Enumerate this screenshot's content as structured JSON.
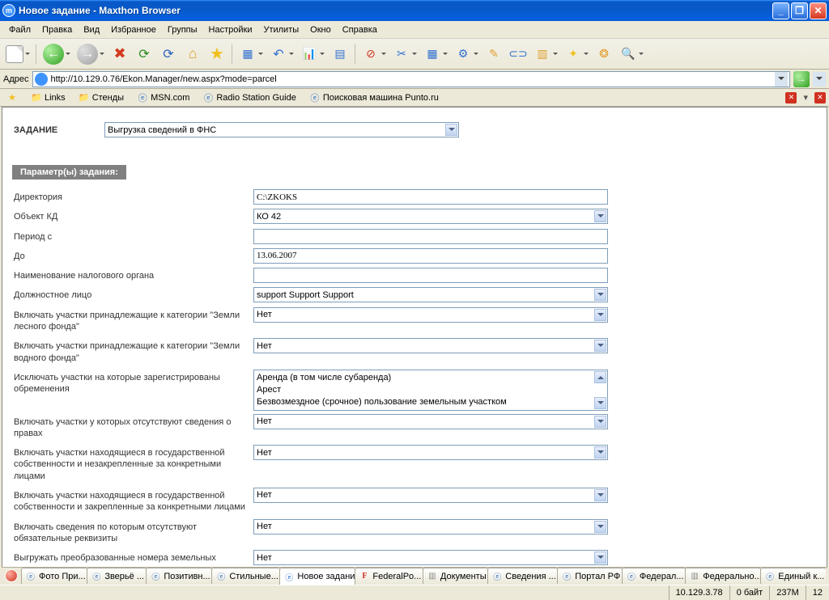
{
  "window": {
    "title": "Новое задание - Maxthon Browser"
  },
  "menu": {
    "items": [
      "Файл",
      "Правка",
      "Вид",
      "Избранное",
      "Группы",
      "Настройки",
      "Утилиты",
      "Окно",
      "Справка"
    ]
  },
  "address": {
    "label": "Адрес",
    "url": "http://10.129.0.76/Ekon.Manager/new.aspx?mode=parcel"
  },
  "links": {
    "items": [
      {
        "icon": "star",
        "label": ""
      },
      {
        "icon": "fold",
        "label": "Links"
      },
      {
        "icon": "fold",
        "label": "Стенды"
      },
      {
        "icon": "ie",
        "label": "MSN.com"
      },
      {
        "icon": "ie",
        "label": "Radio Station Guide"
      },
      {
        "icon": "ie",
        "label": "Поисковая машина Punto.ru"
      }
    ]
  },
  "form": {
    "task_label": "ЗАДАНИЕ",
    "task_value": "Выгрузка сведений в ФНС",
    "section_header": "Параметр(ы) задания:",
    "rows": [
      {
        "label": "Директория",
        "type": "text",
        "value": "C:\\ZKOKS"
      },
      {
        "label": "Объект КД",
        "type": "select",
        "value": "КО 42"
      },
      {
        "label": "Период с",
        "type": "text",
        "value": ""
      },
      {
        "label": "До",
        "type": "text",
        "value": "13.06.2007"
      },
      {
        "label": "Наименование налогового органа",
        "type": "text",
        "value": ""
      },
      {
        "label": "Должностное лицо",
        "type": "select",
        "value": "support Support Support"
      },
      {
        "label": "Включать участки принадлежащие к категории \"Земли лесного фонда\"",
        "type": "select",
        "value": "Нет"
      },
      {
        "label": "Включать участки принадлежащие к категории \"Земли водного фонда\"",
        "type": "select",
        "value": "Нет"
      },
      {
        "label": "Исключать участки на которые зарегистрированы обременения",
        "type": "multi",
        "options": [
          "Аренда (в том числе субаренда)",
          "Арест",
          "Безвозмездное (срочное) пользование земельным участком"
        ]
      },
      {
        "label": "Включать участки у которых отсутствуют сведения о правах",
        "type": "select",
        "value": "Нет"
      },
      {
        "label": "Включать участки находящиеся в государственной собственности и незакрепленные за конкретными лицами",
        "type": "select",
        "value": "Нет"
      },
      {
        "label": "Включать участки находящиеся в государственной собственности и закрепленные за конкретными лицами",
        "type": "select",
        "value": "Нет"
      },
      {
        "label": "Включать сведения по которым отсутствуют обязательные реквизиты",
        "type": "select",
        "value": "Нет"
      },
      {
        "label": "Выгружать преобразованные номера земельных участков",
        "type": "select",
        "value": "Нет"
      }
    ]
  },
  "tabs": {
    "items": [
      {
        "label": "Фото При...",
        "icon": "ie"
      },
      {
        "label": "Зверьё ...",
        "icon": "ie"
      },
      {
        "label": "Позитивн...",
        "icon": "ie"
      },
      {
        "label": "Стильные...",
        "icon": "ie"
      },
      {
        "label": "Новое задание",
        "icon": "ie",
        "active": true
      },
      {
        "label": "FederalPo...",
        "icon": "f"
      },
      {
        "label": "Документы",
        "icon": "doc"
      },
      {
        "label": "Сведения ...",
        "icon": "ie"
      },
      {
        "label": "Портал РФ",
        "icon": "ie"
      },
      {
        "label": "Федерал...",
        "icon": "ie"
      },
      {
        "label": "Федерально...",
        "icon": "doc"
      },
      {
        "label": "Единый к...",
        "icon": "ie"
      }
    ]
  },
  "status": {
    "ip": "10.129.3.78",
    "bytes": "0 байт",
    "mem": "237M",
    "count": "12"
  }
}
